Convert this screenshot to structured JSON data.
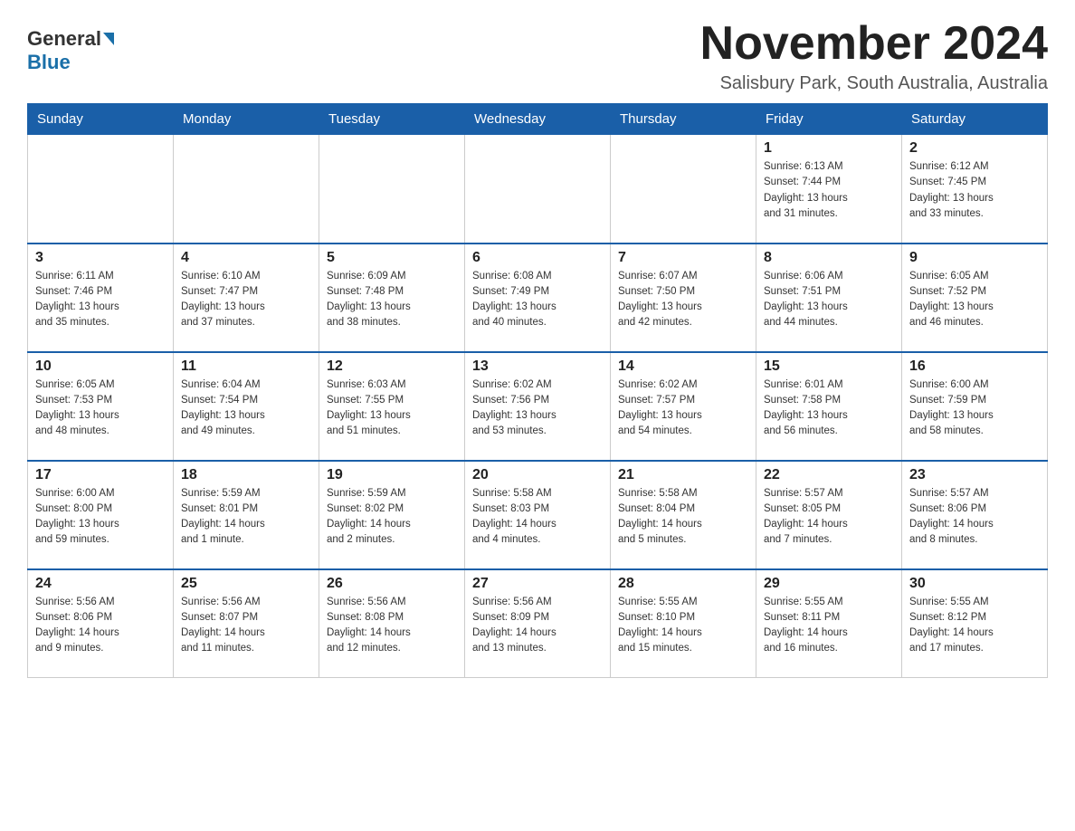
{
  "header": {
    "logo_general": "General",
    "logo_blue": "Blue",
    "month_title": "November 2024",
    "location": "Salisbury Park, South Australia, Australia"
  },
  "weekdays": [
    "Sunday",
    "Monday",
    "Tuesday",
    "Wednesday",
    "Thursday",
    "Friday",
    "Saturday"
  ],
  "weeks": [
    [
      {
        "day": "",
        "info": ""
      },
      {
        "day": "",
        "info": ""
      },
      {
        "day": "",
        "info": ""
      },
      {
        "day": "",
        "info": ""
      },
      {
        "day": "",
        "info": ""
      },
      {
        "day": "1",
        "info": "Sunrise: 6:13 AM\nSunset: 7:44 PM\nDaylight: 13 hours\nand 31 minutes."
      },
      {
        "day": "2",
        "info": "Sunrise: 6:12 AM\nSunset: 7:45 PM\nDaylight: 13 hours\nand 33 minutes."
      }
    ],
    [
      {
        "day": "3",
        "info": "Sunrise: 6:11 AM\nSunset: 7:46 PM\nDaylight: 13 hours\nand 35 minutes."
      },
      {
        "day": "4",
        "info": "Sunrise: 6:10 AM\nSunset: 7:47 PM\nDaylight: 13 hours\nand 37 minutes."
      },
      {
        "day": "5",
        "info": "Sunrise: 6:09 AM\nSunset: 7:48 PM\nDaylight: 13 hours\nand 38 minutes."
      },
      {
        "day": "6",
        "info": "Sunrise: 6:08 AM\nSunset: 7:49 PM\nDaylight: 13 hours\nand 40 minutes."
      },
      {
        "day": "7",
        "info": "Sunrise: 6:07 AM\nSunset: 7:50 PM\nDaylight: 13 hours\nand 42 minutes."
      },
      {
        "day": "8",
        "info": "Sunrise: 6:06 AM\nSunset: 7:51 PM\nDaylight: 13 hours\nand 44 minutes."
      },
      {
        "day": "9",
        "info": "Sunrise: 6:05 AM\nSunset: 7:52 PM\nDaylight: 13 hours\nand 46 minutes."
      }
    ],
    [
      {
        "day": "10",
        "info": "Sunrise: 6:05 AM\nSunset: 7:53 PM\nDaylight: 13 hours\nand 48 minutes."
      },
      {
        "day": "11",
        "info": "Sunrise: 6:04 AM\nSunset: 7:54 PM\nDaylight: 13 hours\nand 49 minutes."
      },
      {
        "day": "12",
        "info": "Sunrise: 6:03 AM\nSunset: 7:55 PM\nDaylight: 13 hours\nand 51 minutes."
      },
      {
        "day": "13",
        "info": "Sunrise: 6:02 AM\nSunset: 7:56 PM\nDaylight: 13 hours\nand 53 minutes."
      },
      {
        "day": "14",
        "info": "Sunrise: 6:02 AM\nSunset: 7:57 PM\nDaylight: 13 hours\nand 54 minutes."
      },
      {
        "day": "15",
        "info": "Sunrise: 6:01 AM\nSunset: 7:58 PM\nDaylight: 13 hours\nand 56 minutes."
      },
      {
        "day": "16",
        "info": "Sunrise: 6:00 AM\nSunset: 7:59 PM\nDaylight: 13 hours\nand 58 minutes."
      }
    ],
    [
      {
        "day": "17",
        "info": "Sunrise: 6:00 AM\nSunset: 8:00 PM\nDaylight: 13 hours\nand 59 minutes."
      },
      {
        "day": "18",
        "info": "Sunrise: 5:59 AM\nSunset: 8:01 PM\nDaylight: 14 hours\nand 1 minute."
      },
      {
        "day": "19",
        "info": "Sunrise: 5:59 AM\nSunset: 8:02 PM\nDaylight: 14 hours\nand 2 minutes."
      },
      {
        "day": "20",
        "info": "Sunrise: 5:58 AM\nSunset: 8:03 PM\nDaylight: 14 hours\nand 4 minutes."
      },
      {
        "day": "21",
        "info": "Sunrise: 5:58 AM\nSunset: 8:04 PM\nDaylight: 14 hours\nand 5 minutes."
      },
      {
        "day": "22",
        "info": "Sunrise: 5:57 AM\nSunset: 8:05 PM\nDaylight: 14 hours\nand 7 minutes."
      },
      {
        "day": "23",
        "info": "Sunrise: 5:57 AM\nSunset: 8:06 PM\nDaylight: 14 hours\nand 8 minutes."
      }
    ],
    [
      {
        "day": "24",
        "info": "Sunrise: 5:56 AM\nSunset: 8:06 PM\nDaylight: 14 hours\nand 9 minutes."
      },
      {
        "day": "25",
        "info": "Sunrise: 5:56 AM\nSunset: 8:07 PM\nDaylight: 14 hours\nand 11 minutes."
      },
      {
        "day": "26",
        "info": "Sunrise: 5:56 AM\nSunset: 8:08 PM\nDaylight: 14 hours\nand 12 minutes."
      },
      {
        "day": "27",
        "info": "Sunrise: 5:56 AM\nSunset: 8:09 PM\nDaylight: 14 hours\nand 13 minutes."
      },
      {
        "day": "28",
        "info": "Sunrise: 5:55 AM\nSunset: 8:10 PM\nDaylight: 14 hours\nand 15 minutes."
      },
      {
        "day": "29",
        "info": "Sunrise: 5:55 AM\nSunset: 8:11 PM\nDaylight: 14 hours\nand 16 minutes."
      },
      {
        "day": "30",
        "info": "Sunrise: 5:55 AM\nSunset: 8:12 PM\nDaylight: 14 hours\nand 17 minutes."
      }
    ]
  ]
}
